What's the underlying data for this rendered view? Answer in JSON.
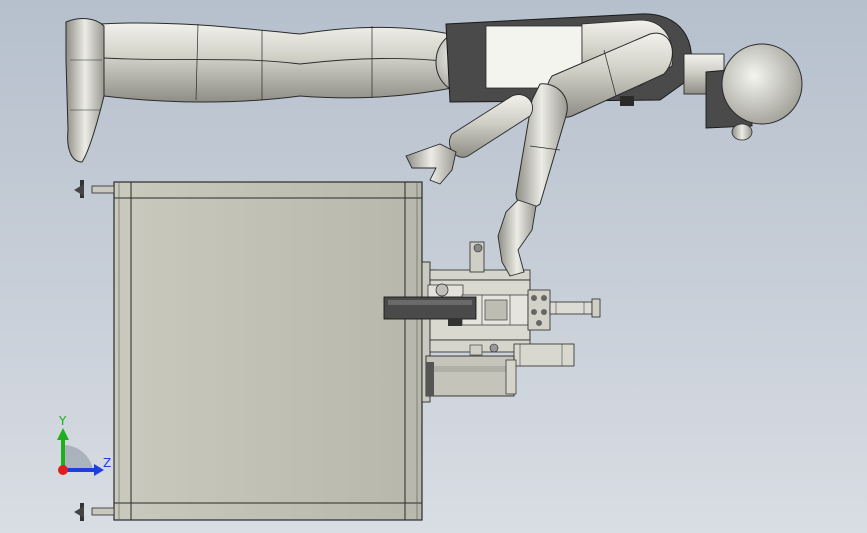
{
  "triad": {
    "y_label": "Y",
    "z_label": "Z",
    "y_color": "#1db01d",
    "z_color": "#1d3fe0",
    "x_color": "#e01d1d"
  },
  "colors": {
    "background_top": "#b6c0cd",
    "background_bottom": "#d9dde4",
    "body_light": "#e6e6e0",
    "body_mid": "#b8b8b0",
    "frame_face": "#c2c2b6",
    "frame_edge": "#3a3a3a",
    "outline": "#2a2a2a",
    "dark_part": "#555555"
  }
}
